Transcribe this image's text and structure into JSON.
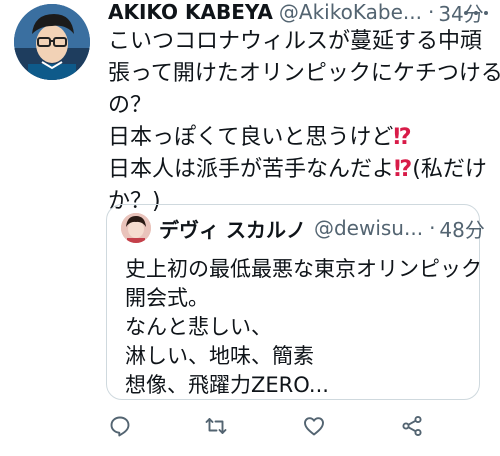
{
  "tweet": {
    "display_name": "AKIKO KABEYA",
    "handle": "@AkikoKabe...",
    "separator": "·",
    "time": "34分",
    "lines": [
      "こいつコロナウィルスが蔓延する中頑",
      "張って開けたオリンピックにケチつける",
      "の？",
      "日本っぽくて良いと思うけど",
      "日本人は派手が苦手なんだよ"
    ],
    "interrobang": "⁉",
    "line5_suffix": "(私だけ",
    "line6": "か？)"
  },
  "quote": {
    "display_name": "デヴィ スカルノ",
    "handle": "@dewisu...",
    "separator": "·",
    "time": "48分",
    "lines": [
      "史上初の最低最悪な東京オリンピック",
      "開会式。",
      "なんと悲しい、",
      "淋しい、地味、簡素",
      "想像、飛躍力ZERO..."
    ]
  },
  "actions": {
    "reply_icon": "reply-icon",
    "retweet_icon": "retweet-icon",
    "like_icon": "heart-icon",
    "share_icon": "share-icon"
  },
  "colors": {
    "text": "#0f1419",
    "secondary": "#536471",
    "border": "#cfd9de",
    "interrobang": "#d81b48"
  }
}
